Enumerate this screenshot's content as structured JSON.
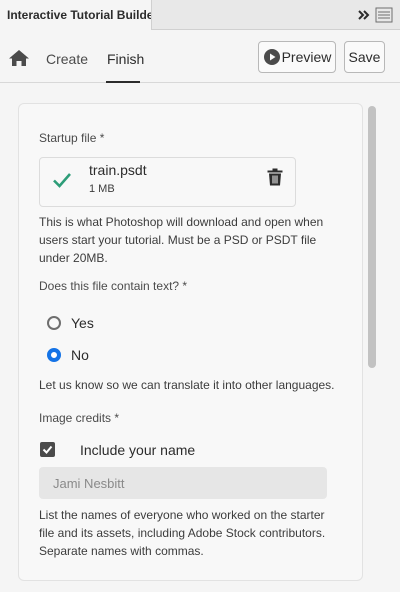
{
  "panel": {
    "title": "Interactive Tutorial Builder"
  },
  "nav": {
    "tabs": [
      {
        "label": "Create",
        "active": false
      },
      {
        "label": "Finish",
        "active": true
      }
    ],
    "preview_label": "Preview",
    "save_label": "Save"
  },
  "startup_file": {
    "label": "Startup file *",
    "file_name": "train.psdt",
    "file_size": "1 MB",
    "help": "This is what Photoshop will download and open when users start your tutorial. Must be a PSD or PSDT file under 20MB."
  },
  "text_question": {
    "label": "Does this file contain text? *",
    "options": [
      {
        "label": "Yes",
        "selected": false
      },
      {
        "label": "No",
        "selected": true
      }
    ],
    "help": "Let us know so we can translate it into other languages."
  },
  "image_credits": {
    "label": "Image credits *",
    "include_name_label": "Include your name",
    "include_name_checked": true,
    "name_value": "Jami Nesbitt",
    "help": "List the names of everyone who worked on the starter file and its assets, including Adobe Stock contributors. Separate names with commas."
  },
  "colors": {
    "accent": "#1473e6",
    "success": "#2d9d78"
  }
}
